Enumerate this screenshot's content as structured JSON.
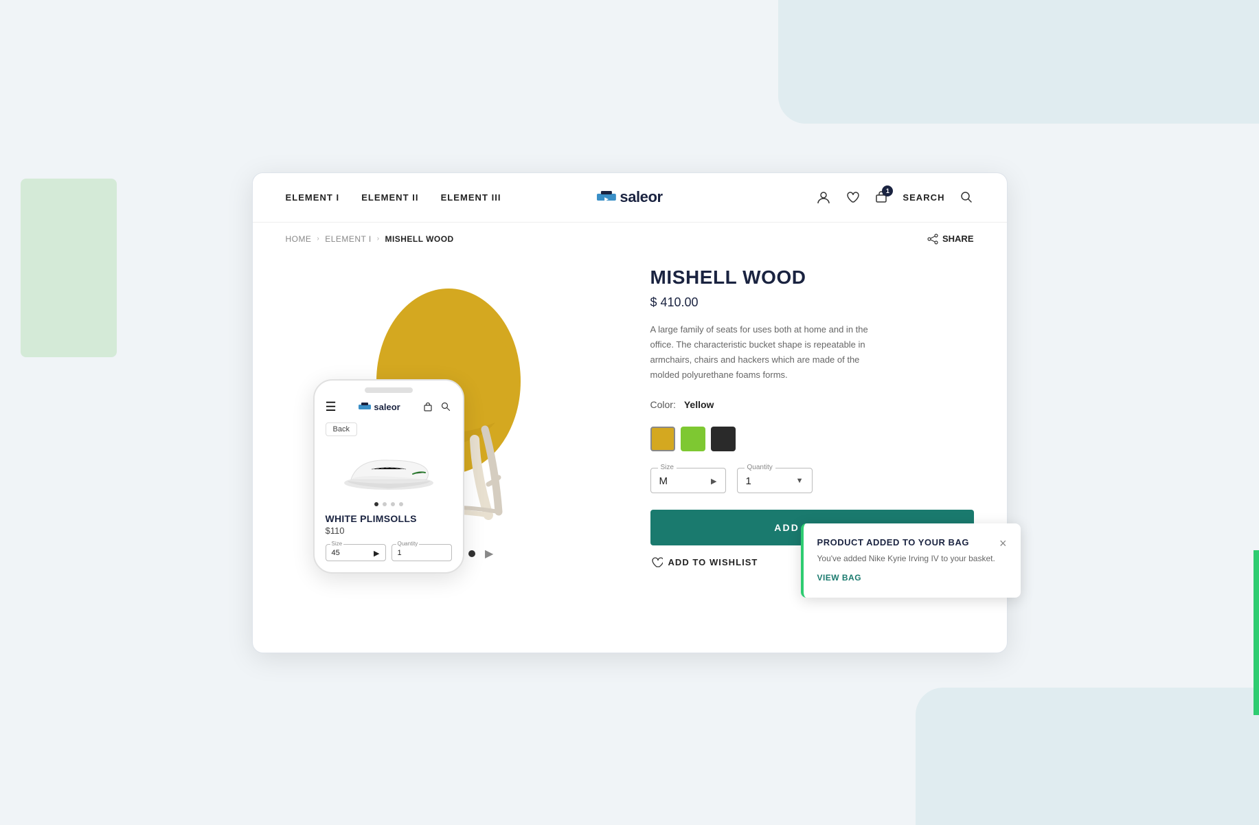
{
  "page": {
    "background_top_right": true,
    "background_bottom_right": true
  },
  "nav": {
    "links": [
      {
        "label": "ELEMENT I"
      },
      {
        "label": "ELEMENT II"
      },
      {
        "label": "ELEMENT III"
      }
    ],
    "logo_text": "saleor",
    "search_label": "SEARCH",
    "cart_badge": "1",
    "actions": {
      "user_icon": "person",
      "wishlist_icon": "heart",
      "cart_icon": "bag",
      "search_icon": "search"
    }
  },
  "breadcrumb": {
    "home": "HOME",
    "element": "ELEMENT I",
    "current": "MISHELL WOOD"
  },
  "share_label": "SHARE",
  "product": {
    "name": "MISHELL WOOD",
    "price": "$ 410.00",
    "description": "A large family of seats for uses both at home and in the office. The characteristic bucket shape is repeatable in armchairs, chairs and hackers which are made of the molded polyurethane foams forms.",
    "color_label": "Color:",
    "color_selected": "Yellow",
    "colors": [
      {
        "id": "yellow",
        "name": "Yellow",
        "hex": "#d4a820",
        "active": true
      },
      {
        "id": "green",
        "name": "Green",
        "hex": "#7ec832",
        "active": false
      },
      {
        "id": "dark",
        "name": "Dark",
        "hex": "#2a2a2a",
        "active": false
      }
    ],
    "size_label": "Size",
    "size_value": "M",
    "quantity_label": "Quantity",
    "quantity_value": "1",
    "add_to_bag_label": "ADD TO BAG",
    "add_to_wishlist_label": "ADD TO WISHLIST",
    "dots": [
      1,
      2,
      3,
      4,
      5
    ],
    "active_dot": 5
  },
  "mobile": {
    "logo_text": "saleor",
    "back_label": "Back",
    "product_name": "WHITE PLIMSOLLS",
    "product_price": "$110",
    "size_label": "Size",
    "size_value": "45",
    "quantity_label": "Quantity",
    "quantity_value": "1",
    "dots": [
      1,
      2,
      3,
      4
    ],
    "active_dot": 1
  },
  "toast": {
    "title": "PRODUCT ADDED TO YOUR BAG",
    "body": "You've added Nike Kyrie Irving IV to your basket.",
    "cta_label": "VIEW BAG",
    "close_icon": "×"
  }
}
